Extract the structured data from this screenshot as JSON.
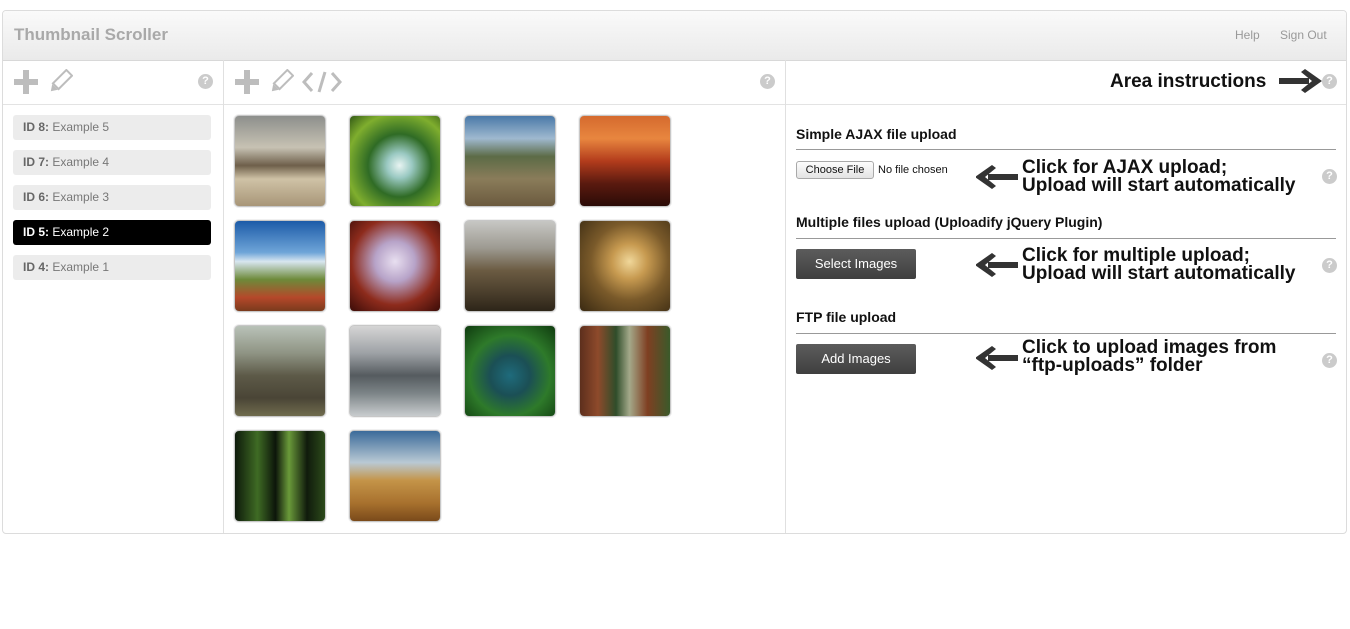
{
  "app": {
    "title": "Thumbnail Scroller"
  },
  "header": {
    "help": "Help",
    "signout": "Sign Out"
  },
  "left_panel": {
    "items": [
      {
        "id": "ID 8:",
        "name": "Example 5",
        "selected": false
      },
      {
        "id": "ID 7:",
        "name": "Example 4",
        "selected": false
      },
      {
        "id": "ID 6:",
        "name": "Example 3",
        "selected": false
      },
      {
        "id": "ID 5:",
        "name": "Example 2",
        "selected": true
      },
      {
        "id": "ID 4:",
        "name": "Example 1",
        "selected": false
      }
    ]
  },
  "help_glyph": "?",
  "thumbnails": [
    "palace-courtyard",
    "mossy-waterfall",
    "mountain-ruins",
    "red-sunset-sea",
    "blue-sky-mountains",
    "red-tree",
    "canyon-valley",
    "misty-forest",
    "castle-ruins",
    "castle-lake",
    "green-lagoon",
    "redwood-cabin",
    "dark-forest",
    "wheat-field"
  ],
  "right_panel": {
    "area_instructions": "Area instructions",
    "sections": [
      {
        "title": "Simple AJAX file upload",
        "button": "Choose File",
        "status": "No file chosen",
        "note_line1": "Click for AJAX upload;",
        "note_line2": "Upload will start automatically"
      },
      {
        "title": "Multiple files upload (Uploadify jQuery Plugin)",
        "button": "Select Images",
        "note_line1": "Click for multiple upload;",
        "note_line2": "Upload will start automatically"
      },
      {
        "title": "FTP file upload",
        "button": "Add Images",
        "note_line1": "Click to upload images from",
        "note_line2": "“ftp-uploads” folder"
      }
    ]
  },
  "colors": {
    "icon_gray": "#bdbdbd",
    "selected_bg": "#000000",
    "button_dark": "#4a4a4a"
  }
}
